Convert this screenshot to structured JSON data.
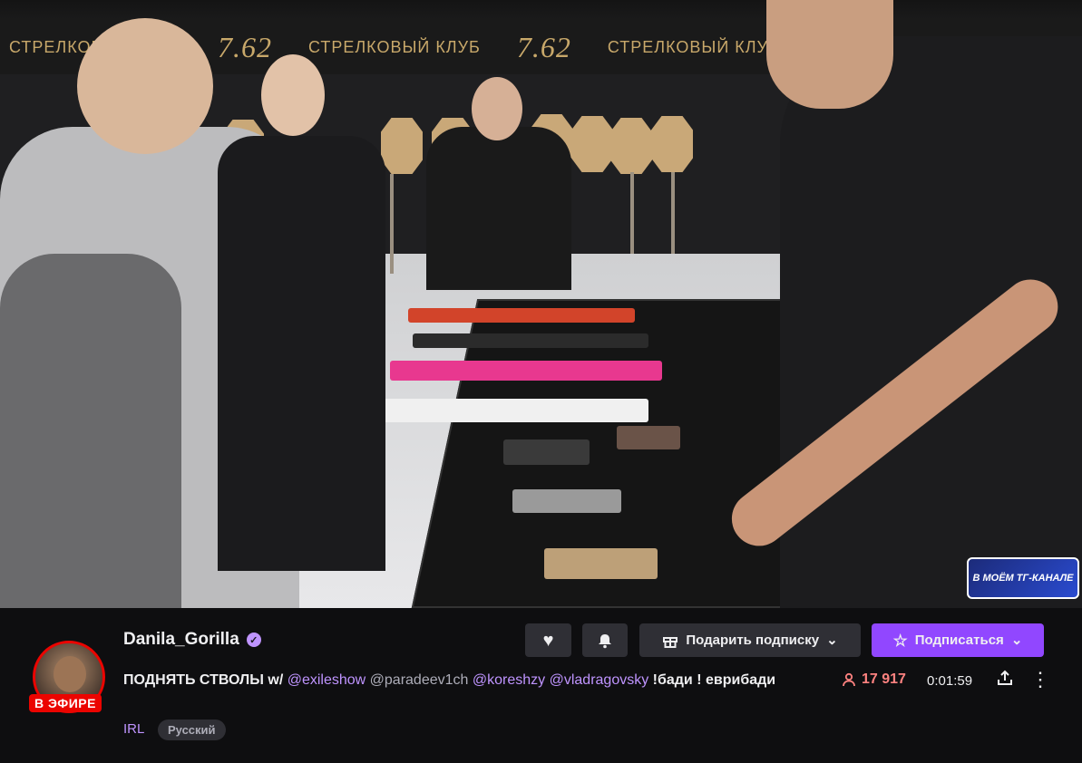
{
  "video": {
    "banner_text": "СТРЕЛКОВЫЙ КЛУБ",
    "banner_number": "7.62",
    "tg_overlay_label": "В МОЁМ ТГ-КАНАЛЕ"
  },
  "channel": {
    "name": "Danila_Gorilla",
    "verified_icon": "verified-icon",
    "live_badge": "В ЭФИРЕ"
  },
  "stream": {
    "title_parts": [
      {
        "text": "ПОДНЯТЬ СТВОЛЫ w/ ",
        "type": "text"
      },
      {
        "text": "@exileshow",
        "type": "mention"
      },
      {
        "text": " @paradeev1ch ",
        "type": "plain"
      },
      {
        "text": "@koreshzy",
        "type": "mention"
      },
      {
        "text": " ",
        "type": "text"
      },
      {
        "text": "@vladragovsky",
        "type": "mention"
      },
      {
        "text": " !бади ! еврибади",
        "type": "text"
      }
    ],
    "category": "IRL",
    "tag": "Русский",
    "viewers": "17 917",
    "uptime": "0:01:59"
  },
  "actions": {
    "follow_icon": "heart-icon",
    "notify_icon": "bell-icon",
    "gift_label": "Подарить подписку",
    "subscribe_label": "Подписаться"
  },
  "colors": {
    "accent": "#9147ff",
    "live": "#eb0400",
    "mention": "#bf94ff",
    "viewers": "#ff8280"
  }
}
